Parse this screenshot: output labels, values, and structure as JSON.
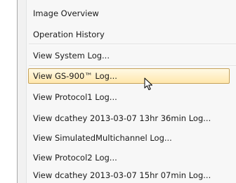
{
  "menu": {
    "items": [
      {
        "label": "Image Overview"
      },
      {
        "label": "Operation History"
      },
      {
        "label": "View System Log..."
      },
      {
        "label": "View GS-900™ Log..."
      },
      {
        "label": "View Protocol1 Log..."
      },
      {
        "label": "View dcathey 2013-03-07 13hr 36min Log..."
      },
      {
        "label": "View SimulatedMultichannel Log..."
      },
      {
        "label": "View Protocol2 Log..."
      },
      {
        "label": "View dcathey 2013-03-07 15hr 07min Log..."
      }
    ],
    "highlighted_item": "View GS-900™ Log...",
    "colors": {
      "highlight_fill_top": "#fff9e4",
      "highlight_fill_bottom": "#ffe7ad",
      "highlight_border": "#c5a25a",
      "menu_background": "#f7f7f7"
    }
  },
  "cursor": {
    "icon": "arrow-pointer-icon"
  }
}
